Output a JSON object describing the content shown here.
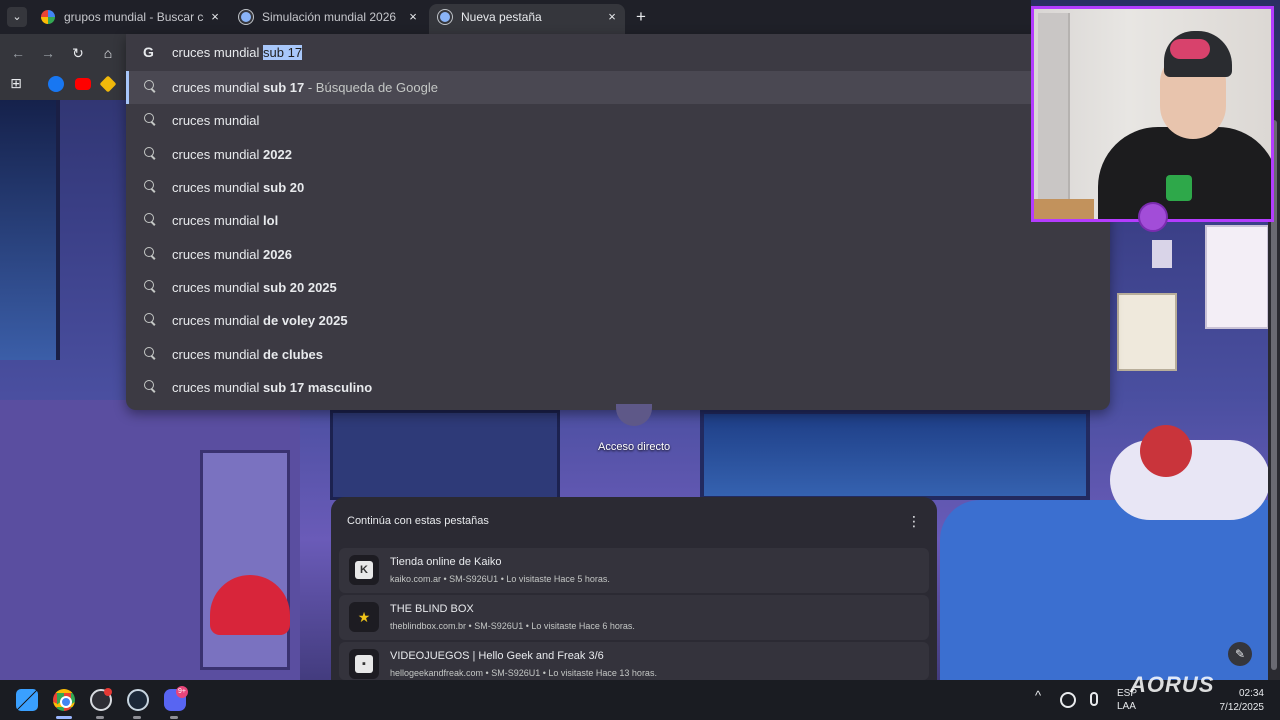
{
  "browser": {
    "tabs": [
      {
        "title": "grupos mundial - Buscar con G",
        "active": false,
        "favicon": "google-icon"
      },
      {
        "title": "Simulación mundial 2026",
        "active": false,
        "favicon": "globe-icon"
      },
      {
        "title": "Nueva pestaña",
        "active": true,
        "favicon": "chrome-icon"
      }
    ],
    "close_glyph": "×",
    "new_tab_glyph": "+",
    "tab_search_glyph": "⌄"
  },
  "toolbar": {
    "back_glyph": "←",
    "forward_glyph": "→",
    "reload_glyph": "↻",
    "home_glyph": "⌂",
    "bookmarks_apps_glyph": "⊞"
  },
  "omnibox": {
    "logo": "G",
    "typed": "cruces mundial ",
    "selected": "sub 17",
    "suggestions": [
      {
        "prefix": "cruces mundial ",
        "bold": "sub 17",
        "suffix": " - Búsqueda de Google",
        "highlighted": true
      },
      {
        "prefix": "cruces mundial",
        "bold": "",
        "suffix": ""
      },
      {
        "prefix": "cruces mundial ",
        "bold": "2022",
        "suffix": ""
      },
      {
        "prefix": "cruces mundial ",
        "bold": "sub 20",
        "suffix": ""
      },
      {
        "prefix": "cruces mundial ",
        "bold": "lol",
        "suffix": ""
      },
      {
        "prefix": "cruces mundial ",
        "bold": "2026",
        "suffix": ""
      },
      {
        "prefix": "cruces mundial ",
        "bold": "sub 20 2025",
        "suffix": ""
      },
      {
        "prefix": "cruces mundial ",
        "bold": "de voley 2025",
        "suffix": ""
      },
      {
        "prefix": "cruces mundial ",
        "bold": "de clubes",
        "suffix": ""
      },
      {
        "prefix": "cruces mundial ",
        "bold": "sub 17 masculino",
        "suffix": ""
      }
    ]
  },
  "newtab": {
    "shortcut_label": "Acceso directo",
    "continue_title": "Continúa con estas pestañas",
    "more_glyph": "⋮",
    "continue_tabs": [
      {
        "title": "Tienda online de Kaiko",
        "sub": "kaiko.com.ar • SM-S926U1 • Lo visitaste Hace 5 horas.",
        "icon": "K"
      },
      {
        "title": "THE BLIND BOX",
        "sub": "theblindbox.com.br • SM-S926U1 • Lo visitaste Hace 6 horas.",
        "icon": "★"
      },
      {
        "title": "VIDEOJUEGOS | Hello Geek and Freak 3/6",
        "sub": "hellogeekandfreak.com • SM-S926U1 • Lo visitaste Hace 13 horas.",
        "icon": "▪"
      }
    ],
    "edit_glyph": "✎"
  },
  "taskbar": {
    "lang_top": "ESP",
    "lang_bottom": "LAA",
    "time": "02:34",
    "date": "7/12/2025",
    "watermark": "AORUS",
    "discord_badge": "9+",
    "tray_chevron": "^"
  }
}
